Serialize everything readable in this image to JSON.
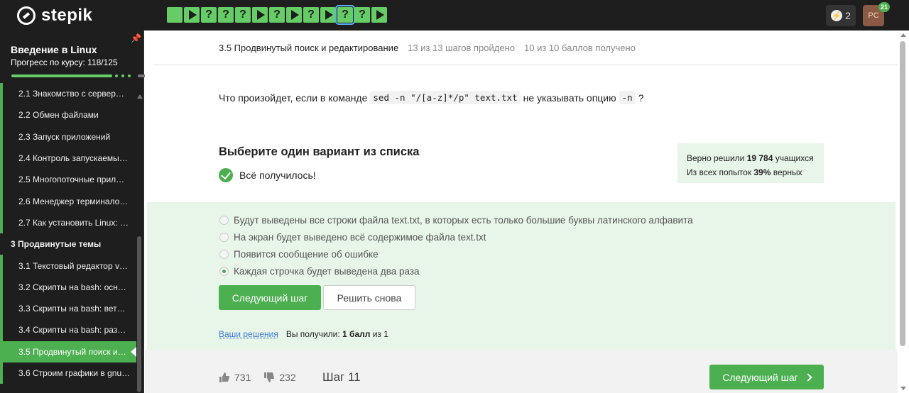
{
  "brand": {
    "name": "stepik"
  },
  "steps": [
    {
      "kind": "text",
      "label": ""
    },
    {
      "kind": "video",
      "label": ""
    },
    {
      "kind": "quiz",
      "label": "?"
    },
    {
      "kind": "quiz",
      "label": "?"
    },
    {
      "kind": "quiz",
      "label": "?"
    },
    {
      "kind": "video",
      "label": ""
    },
    {
      "kind": "quiz",
      "label": "?"
    },
    {
      "kind": "video",
      "label": ""
    },
    {
      "kind": "quiz",
      "label": "?"
    },
    {
      "kind": "video",
      "label": ""
    },
    {
      "kind": "quiz",
      "label": "?",
      "current": true
    },
    {
      "kind": "quiz",
      "label": "?"
    },
    {
      "kind": "video",
      "label": ""
    }
  ],
  "user": {
    "streak": "2",
    "avatar_initials": "PC",
    "notifications": "21"
  },
  "sidebar": {
    "course_title": "Введение в Linux",
    "progress_label": "Прогресс по курсу:  118/125",
    "progress": 0.944,
    "items": [
      {
        "label": "2.1  Знакомство с сервер…",
        "section": false
      },
      {
        "label": "2.2  Обмен файлами",
        "section": false
      },
      {
        "label": "2.3  Запуск приложений",
        "section": false
      },
      {
        "label": "2.4  Контроль запускаемы…",
        "section": false
      },
      {
        "label": "2.5  Многопоточные прил…",
        "section": false
      },
      {
        "label": "2.6  Менеджер терминало…",
        "section": false
      },
      {
        "label": "2.7  Как установить Linux: …",
        "section": false
      },
      {
        "label": "3  Продвинутые темы",
        "section": true
      },
      {
        "label": "3.1  Текстовый редактор v…",
        "section": false
      },
      {
        "label": "3.2  Скрипты на bash: осн…",
        "section": false
      },
      {
        "label": "3.3  Скрипты на bash: вет…",
        "section": false
      },
      {
        "label": "3.4  Скрипты на bash: раз…",
        "section": false
      },
      {
        "label": "3.5  Продвинутый поиск и…",
        "section": false,
        "active": true
      },
      {
        "label": "3.6  Строим графики в gnu…",
        "section": false
      }
    ]
  },
  "header": {
    "lesson": "3.5 Продвинутый поиск и редактирование",
    "steps_done": "13 из 13 шагов пройдено",
    "points": "10 из 10 баллов  получено"
  },
  "question": {
    "before": "Что произойдет, если в команде",
    "code": "sed -n \"/[a-z]*/p\" text.txt",
    "middle": "не указывать опцию",
    "option_code": "-n",
    "after": "?"
  },
  "quiz": {
    "title": "Выберите один вариант из списка",
    "success": "Всё получилось!",
    "stats_line1_pre": "Верно решили ",
    "stats_line1_num": "19 784",
    "stats_line1_post": " учащихся",
    "stats_line2_pre": "Из всех попыток ",
    "stats_line2_num": "39%",
    "stats_line2_post": " верных",
    "options": [
      {
        "text": "Будут выведены все строки файла text.txt, в которых есть только большие буквы латинского алфавита",
        "checked": false
      },
      {
        "text": "На экран будет выведено всё содержимое файла text.txt",
        "checked": false
      },
      {
        "text": "Появится сообщение об ошибке",
        "checked": false
      },
      {
        "text": "Каждая строчка будет выведена два раза",
        "checked": true
      }
    ],
    "next_label": "Следующий шаг",
    "retry_label": "Решить снова",
    "solutions_link": "Ваши решения",
    "result_pre": "Вы получили: ",
    "result_bold": "1 балл",
    "result_post": " из 1"
  },
  "footer": {
    "likes": "731",
    "dislikes": "232",
    "step_label": "Шаг 11",
    "next_label": "Следующий шаг"
  },
  "colors": {
    "accent": "#4caf50",
    "topbar": "#1e1e1e",
    "answer_bg": "#e8f5e9"
  }
}
